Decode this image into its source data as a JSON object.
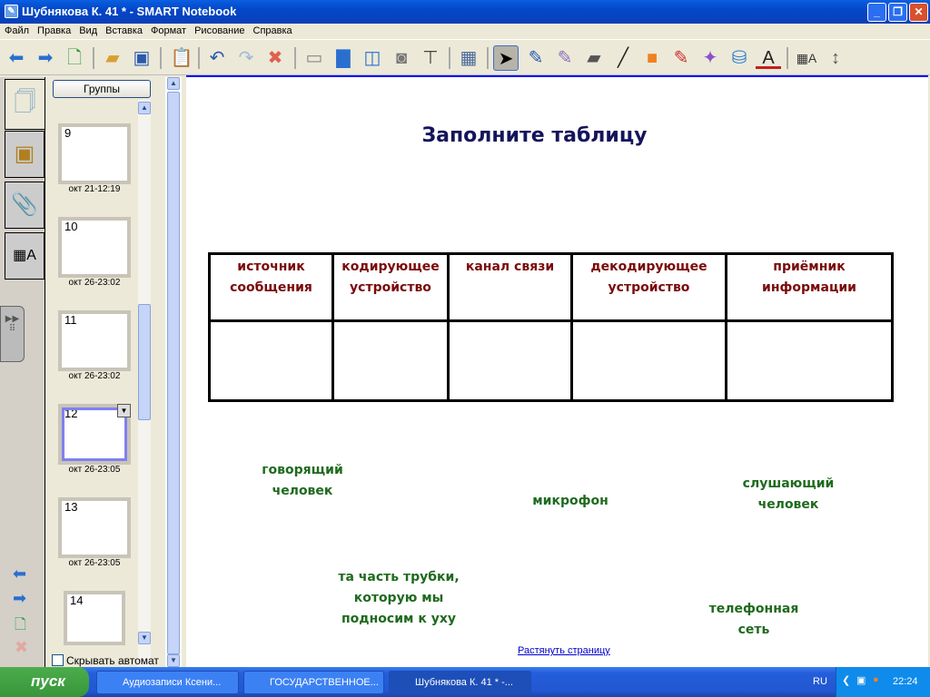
{
  "window": {
    "title": "Шубнякова К. 41 * - SMART Notebook",
    "min": "_",
    "max": "❐",
    "close": "✕"
  },
  "menu": [
    "Файл",
    "Правка",
    "Вид",
    "Вставка",
    "Формат",
    "Рисование",
    "Справка"
  ],
  "toolbar": {
    "icons": [
      "back-arrow",
      "forward-arrow",
      "add-page",
      "open-file",
      "save",
      "paste",
      "undo",
      "redo",
      "delete",
      "screen-shade",
      "full-screen",
      "dual-page",
      "screen-capture",
      "document-camera",
      "table",
      "select",
      "pen",
      "creative-pen",
      "eraser",
      "line",
      "shapes",
      "magic-pen",
      "shape-recognition-pen",
      "fill",
      "text",
      "properties",
      "toolbar-move"
    ]
  },
  "sorter": {
    "groups_button": "Группы",
    "pages": [
      {
        "num": "9",
        "date": "окт 21-12:19"
      },
      {
        "num": "10",
        "date": "окт 26-23:02"
      },
      {
        "num": "11",
        "date": "окт 26-23:02"
      },
      {
        "num": "12",
        "date": "окт 26-23:05"
      },
      {
        "num": "13",
        "date": "окт 26-23:05"
      },
      {
        "num": "14",
        "date": ""
      }
    ],
    "autohide_label": "Скрывать автомат"
  },
  "canvas": {
    "title": "Заполните таблицу",
    "table_headers": [
      [
        "источник",
        "сообщения"
      ],
      [
        "кодирующее",
        "устройство"
      ],
      [
        "канал связи",
        ""
      ],
      [
        "декодирующее",
        "устройство"
      ],
      [
        "приёмник",
        "информации"
      ]
    ],
    "labels": [
      [
        "говорящий",
        "человек"
      ],
      [
        "микрофон"
      ],
      [
        "слушающий",
        "человек"
      ],
      [
        "та часть трубки,",
        "которую мы",
        "подносим к уху"
      ],
      [
        "телефонная",
        "сеть"
      ]
    ],
    "stretch_link": "Растянуть страницу"
  },
  "taskbar": {
    "start": "пуск",
    "tasks": [
      "Аудиозаписи Ксени...",
      "ГОСУДАРСТВЕННОЕ...",
      "Шубнякова К. 41 * -..."
    ],
    "lang": "RU",
    "time": "22:24"
  },
  "colors": {
    "title": "#14145c",
    "header": "#7a0a0a",
    "label": "#1f6a1f"
  }
}
